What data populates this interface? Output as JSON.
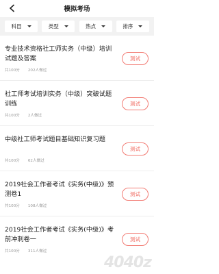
{
  "header": {
    "title": "模拟考场",
    "back_icon": "chevron-left-icon"
  },
  "filters": [
    {
      "label": "科目"
    },
    {
      "label": "类型"
    },
    {
      "label": "热点"
    },
    {
      "label": "排序"
    }
  ],
  "exams": [
    {
      "title": "专业技术资格社工师实务（中级）培训试题及答案",
      "score": "共100分",
      "count": "202人做过",
      "button": "测试"
    },
    {
      "title": "社工师考试培训实务（中级）突破试题训练",
      "score": "共100分",
      "count": "2人做过",
      "button": "测试"
    },
    {
      "title": "中级社工师考试题目基础知识复习题",
      "score": "共100分",
      "count": "62人做过",
      "button": "测试"
    },
    {
      "title": "2019社会工作者考试《实务(中级)》预测卷1",
      "score": "共100分",
      "count": "108人做过",
      "button": "测试"
    },
    {
      "title": "2019社会工作者考试《实务(中级)》考前冲刺卷一",
      "score": "共100分",
      "count": "311人做过",
      "button": "测试"
    }
  ],
  "watermark": "4040z",
  "colors": {
    "accent": "#f0665c",
    "filter_bar": "#f2f2f2",
    "meta_text": "#999999"
  }
}
